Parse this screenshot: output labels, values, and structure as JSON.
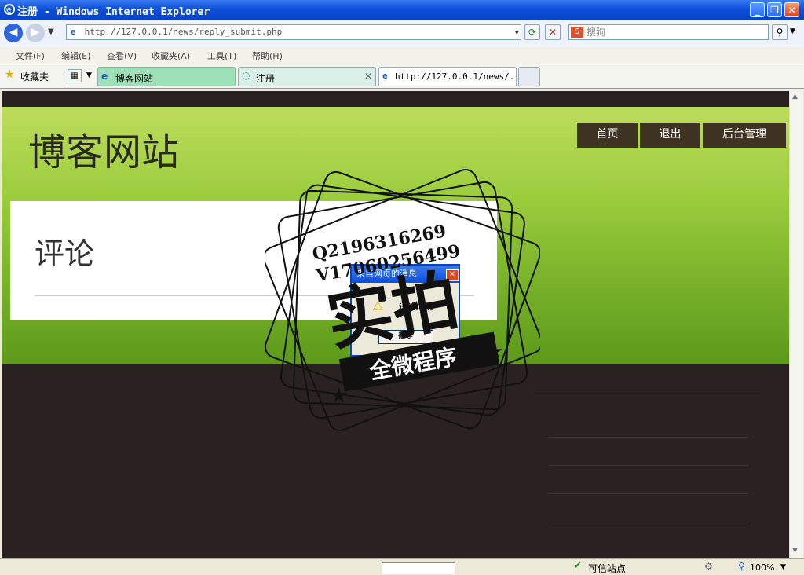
{
  "window": {
    "title": "注册 - Windows Internet Explorer"
  },
  "address": {
    "url": "http://127.0.0.1/news/reply_submit.php",
    "search_placeholder": "搜狗"
  },
  "menus": [
    "文件(F)",
    "编辑(E)",
    "查看(V)",
    "收藏夹(A)",
    "工具(T)",
    "帮助(H)"
  ],
  "favorites_label": "收藏夹",
  "tabs": [
    {
      "label": "博客网站"
    },
    {
      "label": "注册"
    },
    {
      "label": "http://127.0.0.1/news/..."
    }
  ],
  "site": {
    "title": "博客网站",
    "nav": [
      "首页",
      "退出",
      "后台管理"
    ],
    "comment_title": "评论"
  },
  "dialog": {
    "title": "来自网页的消息",
    "message": "评论成功",
    "ok_label": "确定"
  },
  "watermark": {
    "line1": "Q2196316269",
    "line2": "V17060256499",
    "main": "实拍",
    "sub": "全微程序"
  },
  "status": {
    "zone": "可信站点",
    "zoom": "100%"
  }
}
